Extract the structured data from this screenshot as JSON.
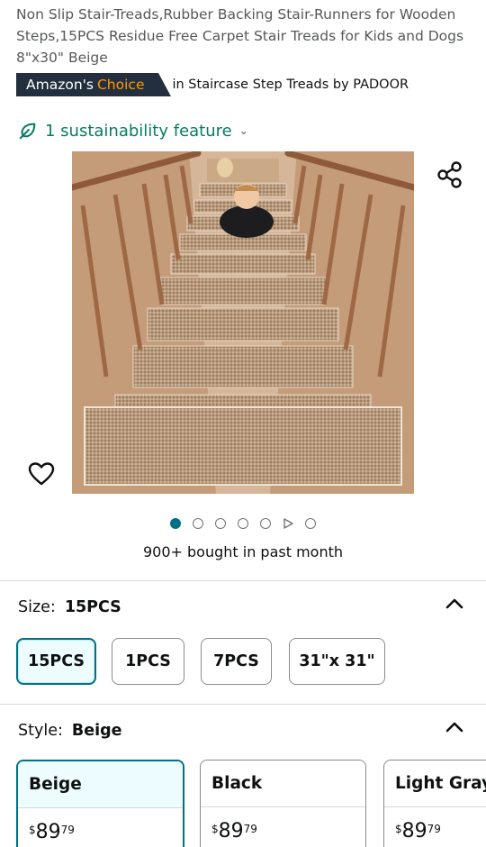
{
  "product": {
    "title": "Non Slip Stair-Treads,Rubber Backing Stair-Runners for Wooden Steps,15PCS Residue Free Carpet Stair Treads for Kids and Dogs 8\"x30\" Beige",
    "badge_prefix": "Amazon's",
    "badge_choice": "Choice",
    "badge_category": "in Staircase Step Treads by PADOOR",
    "sustainability": "1 sustainability feature",
    "bought": "900+ bought in past month",
    "image_count": 6,
    "active_image": 1
  },
  "size": {
    "label": "Size:",
    "selected": "15PCS",
    "options": [
      "15PCS",
      "1PCS",
      "7PCS",
      "31\"x 31\""
    ]
  },
  "style": {
    "label": "Style:",
    "selected": "Beige",
    "options": [
      {
        "name": "Beige",
        "currency": "$",
        "dollars": "89",
        "cents": "79"
      },
      {
        "name": "Black",
        "currency": "$",
        "dollars": "89",
        "cents": "79"
      },
      {
        "name": "Light Gray",
        "currency": "$",
        "dollars": "89",
        "cents": "79"
      }
    ]
  },
  "colors": {
    "accent": "#007185",
    "sustain": "#067d62",
    "badge_bg": "#232f3e",
    "badge_choice": "#ff9900",
    "selected_bg": "#edfdff"
  },
  "icons": {
    "share": "share-icon",
    "wishlist": "heart-icon",
    "sustain": "leaf-icon",
    "collapse": "chevron-up-icon"
  }
}
